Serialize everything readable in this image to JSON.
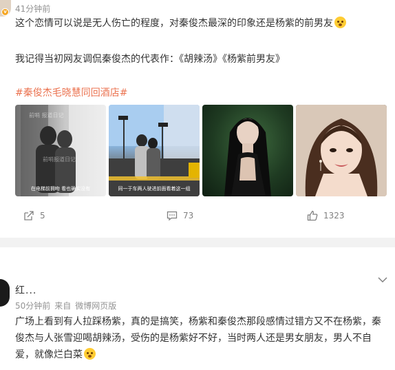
{
  "post1": {
    "time": "41分钟前",
    "text_line1": "这个恋情可以说是无人伤亡的程度，对秦俊杰最深的印象还是杨紫的前男友",
    "text_line2": "我记得当初网友调侃秦俊杰的代表作：《胡辣汤》《杨紫前男友》",
    "hashtag": "#秦俊杰毛晓慧同回酒店#",
    "photos": [
      {
        "caption": "在电梯前拥吻 看也确实没有",
        "icon": "photo-couple-street"
      },
      {
        "caption": "同一于车两人驶进前面看着这一组",
        "icon": "photo-couple-car"
      },
      {
        "caption": "",
        "icon": "photo-woman-dark"
      },
      {
        "caption": "",
        "icon": "photo-woman-smile"
      }
    ],
    "actions": {
      "share_count": "5",
      "comment_count": "73",
      "like_count": "1323"
    }
  },
  "post2": {
    "username": "红...",
    "time": "50分钟前",
    "source_prefix": "来自",
    "source": "微博网页版",
    "text": "广场上看到有人拉踩杨紫，真的是搞笑，杨紫和秦俊杰那段感情过错方又不在杨紫，秦俊杰与人张雪迎喝胡辣汤，受伤的是杨紫好不好，当时两人还是男女朋友，男人不自爱，就像烂白菜"
  },
  "colors": {
    "hashtag": "#eb7350",
    "meta": "#939393",
    "separator": "#f2f2f2"
  }
}
